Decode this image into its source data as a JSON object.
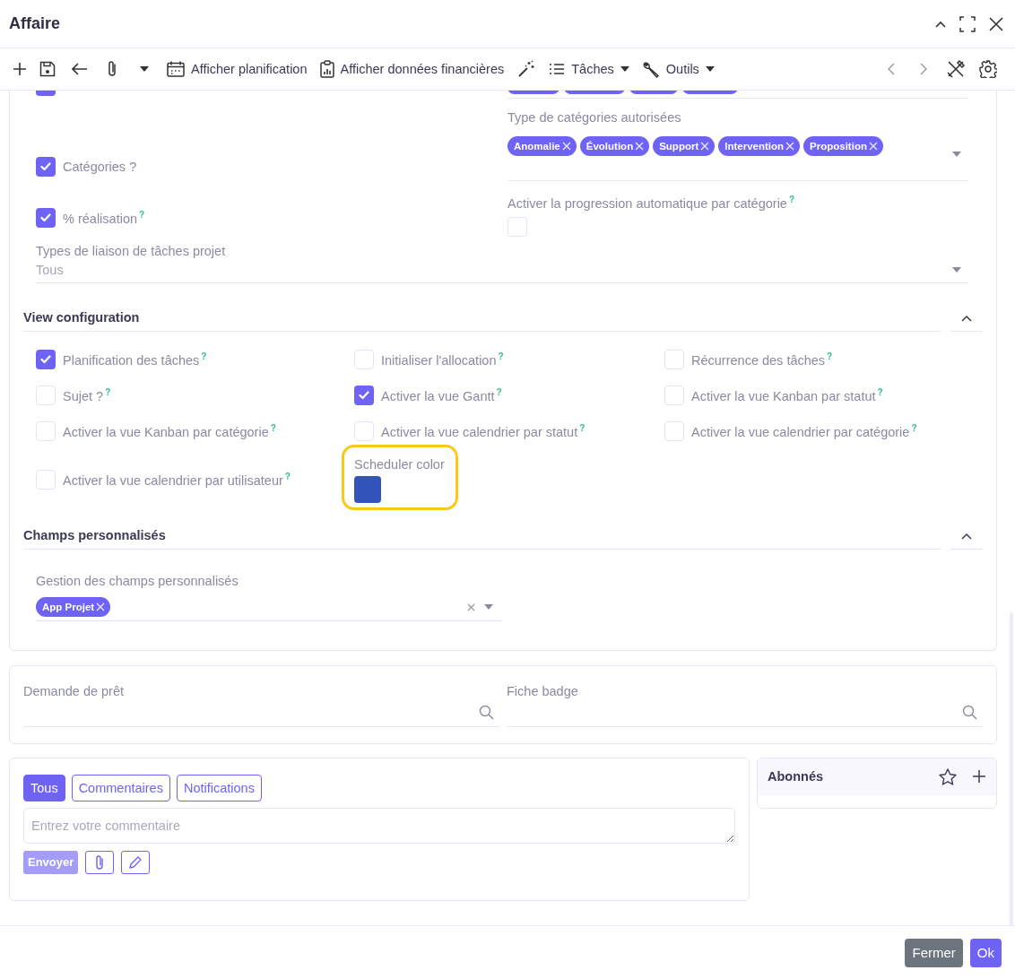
{
  "window": {
    "title": "Affaire"
  },
  "toolbar": [
    {
      "label": "Afficher planification"
    },
    {
      "label": "Afficher données financières"
    },
    {
      "label": "Tâches"
    },
    {
      "label": "Outils"
    }
  ],
  "form": {
    "top_partial": {
      "checked": true
    },
    "categories_enabled": {
      "label": "Catégories ?",
      "checked": true
    },
    "allowed_categories": {
      "label": "Type de catégories autorisées",
      "tags": [
        "Anomalie",
        "Évolution",
        "Support",
        "Intervention",
        "Proposition"
      ]
    },
    "progress": {
      "label": "% réalisation",
      "help": "?",
      "checked": true
    },
    "auto_progress": {
      "label": "Activer la progression automatique par catégorie",
      "help": "?",
      "checked": false
    },
    "link_types": {
      "label": "Types de liaison de tâches projet",
      "value": "Tous"
    }
  },
  "view_configuration": {
    "title": "View configuration",
    "expanded": true,
    "options": [
      {
        "kind": "checkbox",
        "label": "Planification des tâches",
        "help": "?",
        "checked": true
      },
      {
        "kind": "checkbox",
        "label": "Initialiser l'allocation",
        "help": "?",
        "checked": false
      },
      {
        "kind": "checkbox",
        "label": "Récurrence des tâches",
        "help": "?",
        "checked": false
      },
      {
        "kind": "checkbox",
        "label": "Sujet ?",
        "help": "?",
        "checked": false
      },
      {
        "kind": "checkbox",
        "label": "Activer la vue Gantt",
        "help": "?",
        "checked": true
      },
      {
        "kind": "checkbox",
        "label": "Activer la vue Kanban par statut",
        "help": "?",
        "checked": false
      },
      {
        "kind": "checkbox",
        "label": "Activer la vue Kanban par catégorie",
        "help": "?",
        "checked": false
      },
      {
        "kind": "checkbox",
        "label": "Activer la vue calendrier par statut",
        "help": "?",
        "checked": false
      },
      {
        "kind": "checkbox",
        "label": "Activer la vue calendrier par catégorie",
        "help": "?",
        "checked": false
      },
      {
        "kind": "checkbox",
        "label": "Activer la vue calendrier par utilisateur",
        "help": "?",
        "checked": false
      },
      {
        "kind": "color",
        "label": "Scheduler color",
        "color": "#3355bb",
        "highlighted": true
      }
    ]
  },
  "custom_fields": {
    "title": "Champs personnalisés",
    "expanded": true,
    "field": {
      "label": "Gestion des champs personnalisés",
      "tags": [
        "App Projet"
      ]
    }
  },
  "references": [
    {
      "label": "Demande de prêt"
    },
    {
      "label": "Fiche badge"
    }
  ],
  "messages": {
    "tabs": [
      {
        "label": "Tous",
        "selected": true
      },
      {
        "label": "Commentaires",
        "selected": false
      },
      {
        "label": "Notifications",
        "selected": false
      }
    ],
    "placeholder": "Entrez votre commentaire",
    "send": "Envoyer"
  },
  "followers": {
    "title": "Abonnés"
  },
  "footer": {
    "buttons": [
      {
        "label": "Fermer",
        "kind": "secondary"
      },
      {
        "label": "Ok",
        "kind": "primary"
      }
    ]
  }
}
